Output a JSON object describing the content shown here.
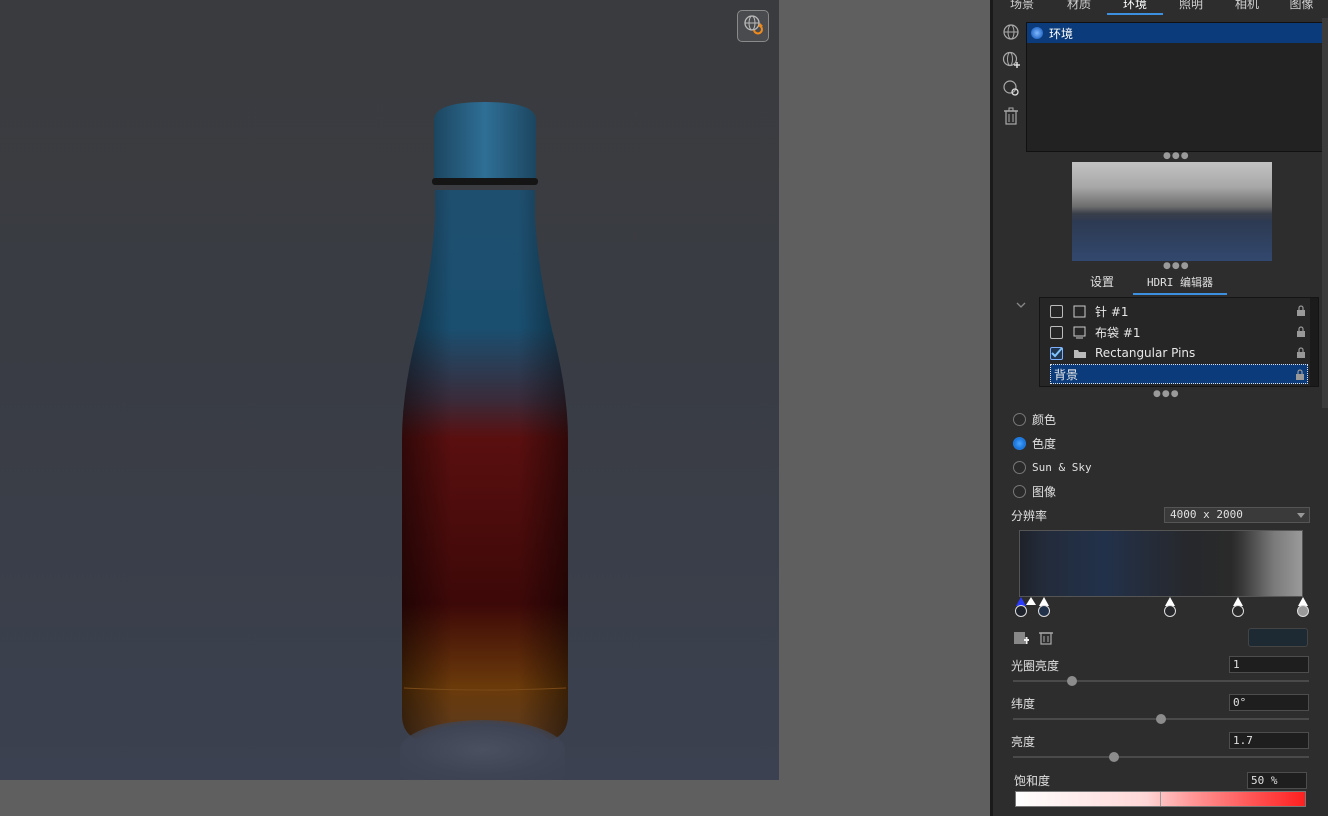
{
  "tabs": [
    {
      "label": "场景"
    },
    {
      "label": "材质"
    },
    {
      "label": "环境"
    },
    {
      "label": "照明"
    },
    {
      "label": "相机"
    },
    {
      "label": "图像"
    }
  ],
  "environment_list": {
    "items": [
      {
        "label": "环境"
      }
    ]
  },
  "subtabs": [
    {
      "label": "设置"
    },
    {
      "label": "HDRI 编辑器"
    }
  ],
  "tree": {
    "rows": [
      {
        "label": "针 #1",
        "checked": false
      },
      {
        "label": "布袋 #1",
        "checked": false
      },
      {
        "label": "Rectangular Pins",
        "checked": true
      },
      {
        "label": "背景",
        "selected": true
      }
    ]
  },
  "background_modes": [
    {
      "label": "颜色",
      "selected": false
    },
    {
      "label": "色度",
      "selected": true
    },
    {
      "label": "Sun & Sky",
      "selected": false
    },
    {
      "label": "图像",
      "selected": false
    }
  ],
  "resolution": {
    "label": "分辨率",
    "value": "4000 x 2000"
  },
  "params": {
    "aperture_brightness": {
      "label": "光圈亮度",
      "value": "1",
      "level": 0.2
    },
    "latitude": {
      "label": "纬度",
      "value": "0°",
      "level": 0.5
    },
    "brightness": {
      "label": "亮度",
      "value": "1.7",
      "level": 0.34
    },
    "saturation": {
      "label": "饱和度",
      "value": "50 %"
    }
  },
  "colors": {
    "accent": "#3d8fe0",
    "selection": "#0b3b7a",
    "panel_bg": "#2d2d2d"
  }
}
